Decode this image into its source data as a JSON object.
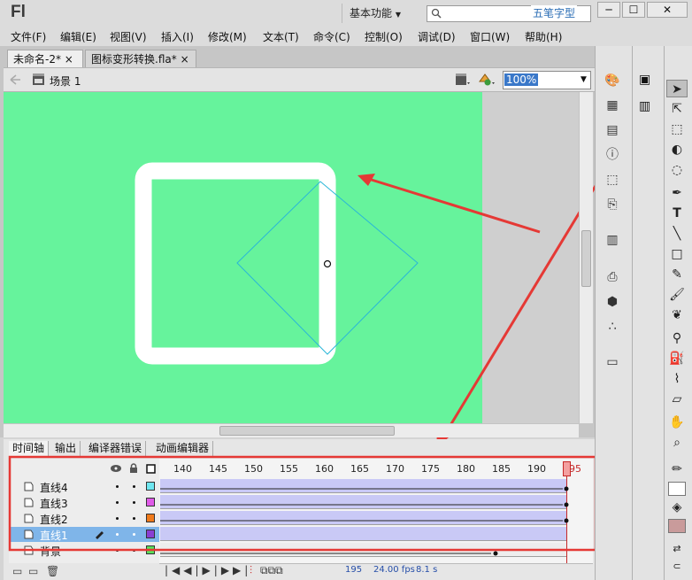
{
  "app": {
    "logo": "Fl",
    "workspace": "基本功能",
    "watermark": "五笔字型"
  },
  "window_buttons": [
    "─",
    "☐",
    "✕"
  ],
  "menu": [
    "文件(F)",
    "编辑(E)",
    "视图(V)",
    "插入(I)",
    "修改(M)",
    "文本(T)",
    "命令(C)",
    "控制(O)",
    "调试(D)",
    "窗口(W)",
    "帮助(H)"
  ],
  "tabs": [
    {
      "label": "未命名-2*",
      "close": "×"
    },
    {
      "label": "图标变形转换.fla*",
      "close": "×"
    }
  ],
  "editbar": {
    "scene": "场景 1",
    "zoom": "100%"
  },
  "panel_tabs": [
    "时间轴",
    "输出",
    "编译器错误",
    "动画编辑器"
  ],
  "ruler": [
    "140",
    "145",
    "150",
    "155",
    "160",
    "165",
    "170",
    "175",
    "180",
    "185",
    "190",
    "195"
  ],
  "layers": [
    {
      "name": "直线4",
      "color": "#6fe7f0"
    },
    {
      "name": "直线3",
      "color": "#e05ae8"
    },
    {
      "name": "直线2",
      "color": "#f07a1a"
    },
    {
      "name": "直线1",
      "color": "#8a3fd3"
    },
    {
      "name": "背景",
      "color": "#58e05a"
    }
  ],
  "status": {
    "frame": "195",
    "fps": "24.00 fps",
    "time": "8.1 s"
  },
  "colors": {
    "stage": "#66f39c",
    "highlight": "#e53935",
    "selected_layer": "#7fb5e9"
  },
  "icons": [
    "search-icon",
    "close-icon",
    "back-arrow-icon",
    "scene-icon",
    "edit-symbol-icon",
    "chevron-down-icon",
    "eye-icon",
    "lock-icon",
    "outline-icon",
    "pencil-icon",
    "selection-tool-icon",
    "text-tool-icon",
    "hand-tool-icon",
    "zoom-tool-icon"
  ]
}
